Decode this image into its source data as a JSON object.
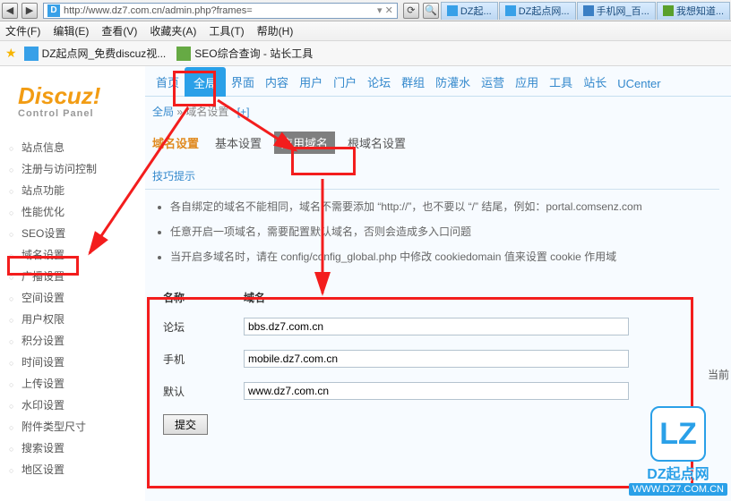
{
  "browser": {
    "url": "http://www.dz7.com.cn/admin.php?frames=",
    "tabs": [
      "DZ起...",
      "DZ起点网...",
      "手机网_百...",
      "我想知道..."
    ]
  },
  "menubar": [
    "文件(F)",
    "编辑(E)",
    "查看(V)",
    "收藏夹(A)",
    "工具(T)",
    "帮助(H)"
  ],
  "bookmarks": [
    "DZ起点网_免费discuz视...",
    "SEO综合查询 - 站长工具"
  ],
  "logo": {
    "title": "Discuz!",
    "subtitle": "Control Panel"
  },
  "sidebar": {
    "items": [
      "站点信息",
      "注册与访问控制",
      "站点功能",
      "性能优化",
      "SEO设置",
      "域名设置",
      "广播设置",
      "空间设置",
      "用户权限",
      "积分设置",
      "时间设置",
      "上传设置",
      "水印设置",
      "附件类型尺寸",
      "搜索设置",
      "地区设置"
    ]
  },
  "topnav": [
    "首页",
    "全局",
    "界面",
    "内容",
    "用户",
    "门户",
    "论坛",
    "群组",
    "防灌水",
    "运营",
    "应用",
    "工具",
    "站长",
    "UCenter"
  ],
  "breadcrumb": {
    "a": "全局",
    "sep": "»",
    "b": "域名设置",
    "plus": "[+]"
  },
  "subtabs": {
    "title": "域名设置",
    "items": [
      "基本设置",
      "应用域名",
      "根域名设置"
    ]
  },
  "tips": {
    "heading": "技巧提示",
    "lines": [
      "各自绑定的域名不能相同，域名不需要添加 “http://”，也不要以 “/” 结尾，例如：portal.comsenz.com",
      "任意开启一项域名，需要配置默认域名，否则会造成多入口问题",
      "当开启多域名时，请在 config/config_global.php 中修改 cookiedomain 值来设置 cookie 作用域"
    ]
  },
  "form": {
    "header": {
      "name": "名称",
      "domain": "域名"
    },
    "rows": [
      {
        "label": "论坛",
        "value": "bbs.dz7.com.cn"
      },
      {
        "label": "手机",
        "value": "mobile.dz7.com.cn"
      },
      {
        "label": "默认",
        "value": "www.dz7.com.cn"
      }
    ],
    "submit": "提交",
    "extra": "当前"
  },
  "watermark": {
    "logo": "LZ",
    "name": "DZ起点网",
    "url": "WWW.DZ7.COM.CN"
  }
}
